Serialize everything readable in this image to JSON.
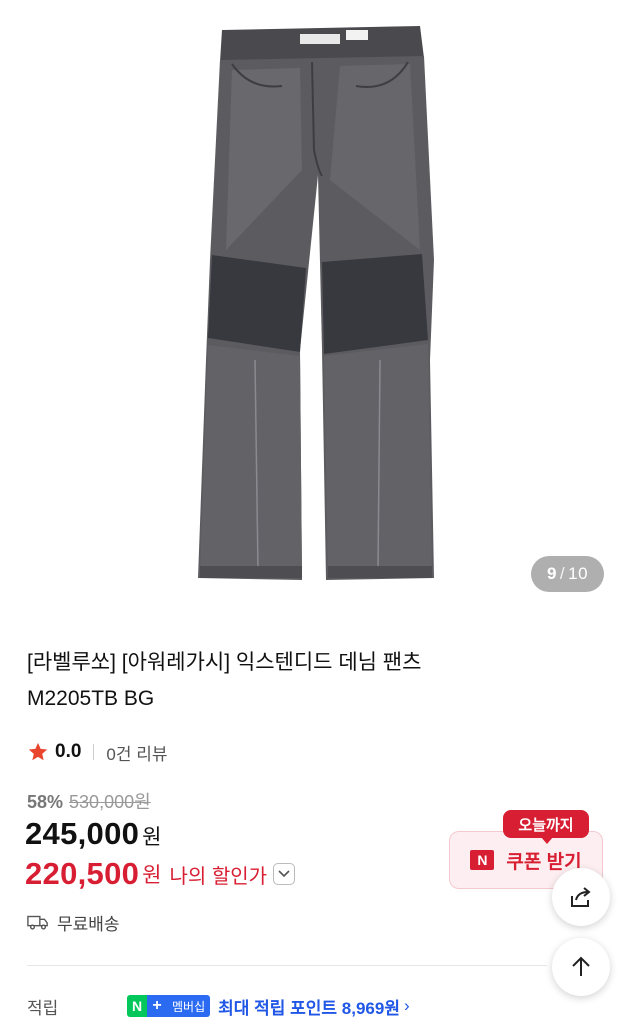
{
  "gallery": {
    "current": "9",
    "separator": "/",
    "total": "10"
  },
  "product": {
    "title_line1": "[라벨루쏘] [아워레가시] 익스텐디드 데님 팬츠",
    "title_line2": "M2205TB BG",
    "rating": "0.0",
    "reviews": "0건 리뷰",
    "discount_pct": "58%",
    "original_price": "530,000원",
    "price": "245,000",
    "price_unit": "원",
    "my_price": "220,500",
    "my_price_unit": "원",
    "my_price_label": "나의 할인가",
    "shipping": "무료배송"
  },
  "coupon": {
    "badge": "오늘까지",
    "n_icon": "N",
    "label": "쿠폰 받기"
  },
  "points": {
    "label": "적립",
    "n_badge": "N",
    "plus_badge": "+",
    "membership_badge": "멤버십",
    "text": "최대 적립 포인트 8,969원",
    "arrow": "›"
  },
  "icons": {
    "star": "star-icon",
    "truck": "truck-icon",
    "share": "share-icon",
    "top": "arrow-up-icon",
    "chevron": "chevron-down-icon"
  },
  "colors": {
    "accent_red": "#d81e32",
    "naver_green": "#03c75a",
    "naver_blue": "#2157e6",
    "star": "#e8452c"
  }
}
